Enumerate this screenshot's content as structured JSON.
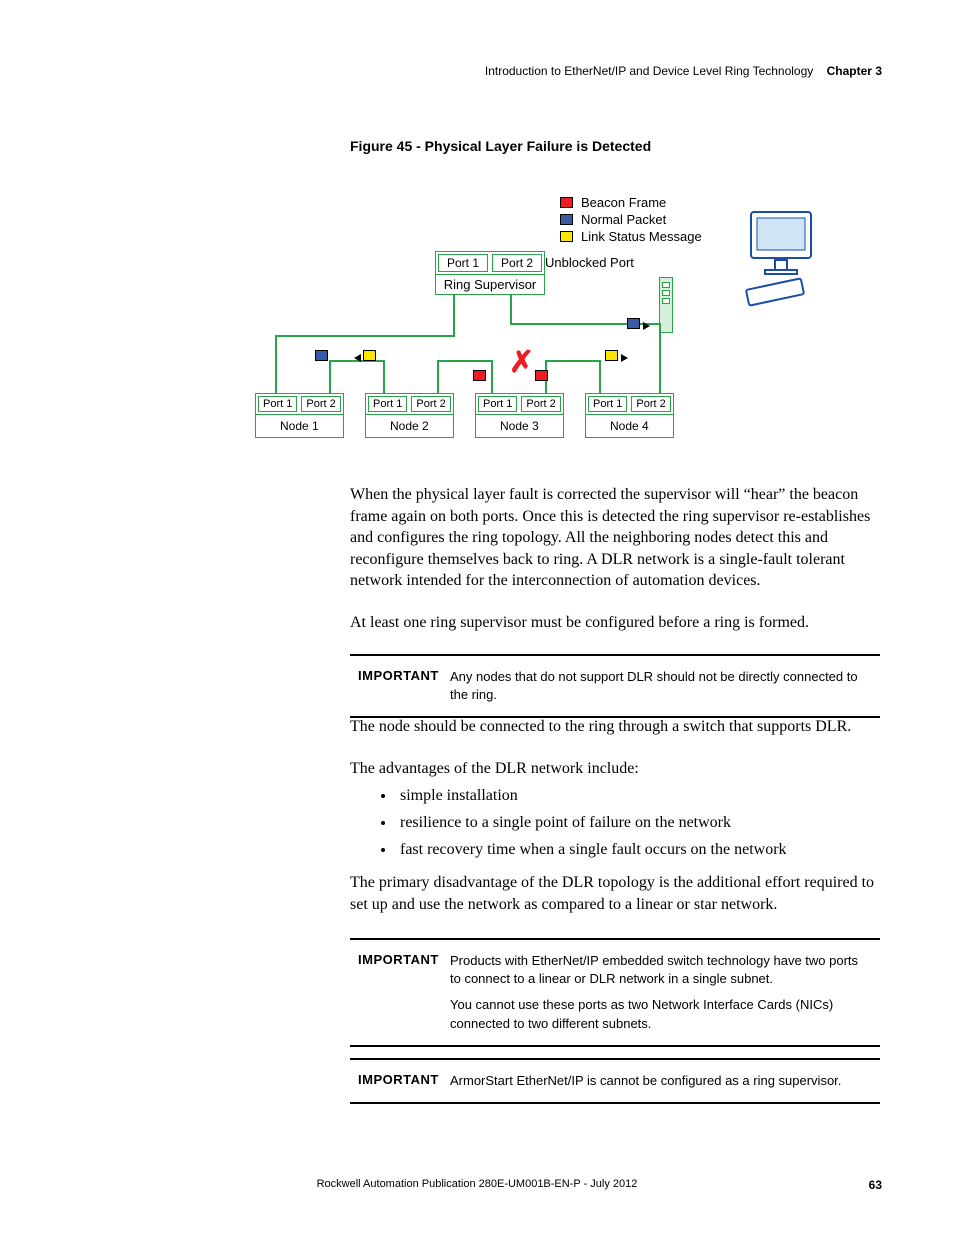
{
  "header": {
    "title": "Introduction to EtherNet/IP and Device Level Ring Technology",
    "chapter": "Chapter 3"
  },
  "figure": {
    "caption": "Figure 45 - Physical Layer Failure is Detected",
    "legend": {
      "beacon": "Beacon Frame",
      "normal": "Normal Packet",
      "linkstatus": "Link Status Message"
    },
    "supervisor": {
      "port1": "Port 1",
      "port2": "Port 2",
      "label": "Ring Supervisor"
    },
    "unblocked": "Unblocked Port",
    "nodes": [
      {
        "p1": "Port 1",
        "p2": "Port 2",
        "label": "Node 1"
      },
      {
        "p1": "Port 1",
        "p2": "Port 2",
        "label": "Node 2"
      },
      {
        "p1": "Port 1",
        "p2": "Port 2",
        "label": "Node 3"
      },
      {
        "p1": "Port 1",
        "p2": "Port 2",
        "label": "Node 4"
      }
    ]
  },
  "para1": "When the physical layer fault is corrected the supervisor will “hear” the beacon frame again on both ports. Once this is detected the ring supervisor re-establishes and configures the ring topology. All the neighboring nodes detect this and reconfigure themselves back to ring. A DLR network is a single-fault tolerant network intended for the interconnection of automation devices.",
  "para2": "At least one ring supervisor must be configured before a ring is formed.",
  "important1": {
    "label": "IMPORTANT",
    "text": "Any nodes that do not support DLR should not be directly connected to the ring."
  },
  "para3": "The node should be connected to the ring through a switch that supports DLR.",
  "para4": "The advantages of the DLR network include:",
  "bullets": {
    "b1": "simple installation",
    "b2": "resilience to a single point of failure on the network",
    "b3": "fast recovery time when a single fault occurs on the network"
  },
  "para5": "The primary disadvantage of the DLR topology is the additional effort required to set up and use the network as compared to a linear or star network.",
  "important2": {
    "label": "IMPORTANT",
    "p1": "Products with EtherNet/IP embedded switch technology have two ports to connect to a linear or DLR network in a single subnet.",
    "p2": "You cannot use these ports as two Network Interface Cards (NICs) connected to two different subnets."
  },
  "important3": {
    "label": "IMPORTANT",
    "text": "ArmorStart EtherNet/IP is cannot be configured as a ring supervisor."
  },
  "footer": {
    "pub": "Rockwell Automation Publication 280E-UM001B-EN-P - July 2012",
    "page": "63"
  }
}
